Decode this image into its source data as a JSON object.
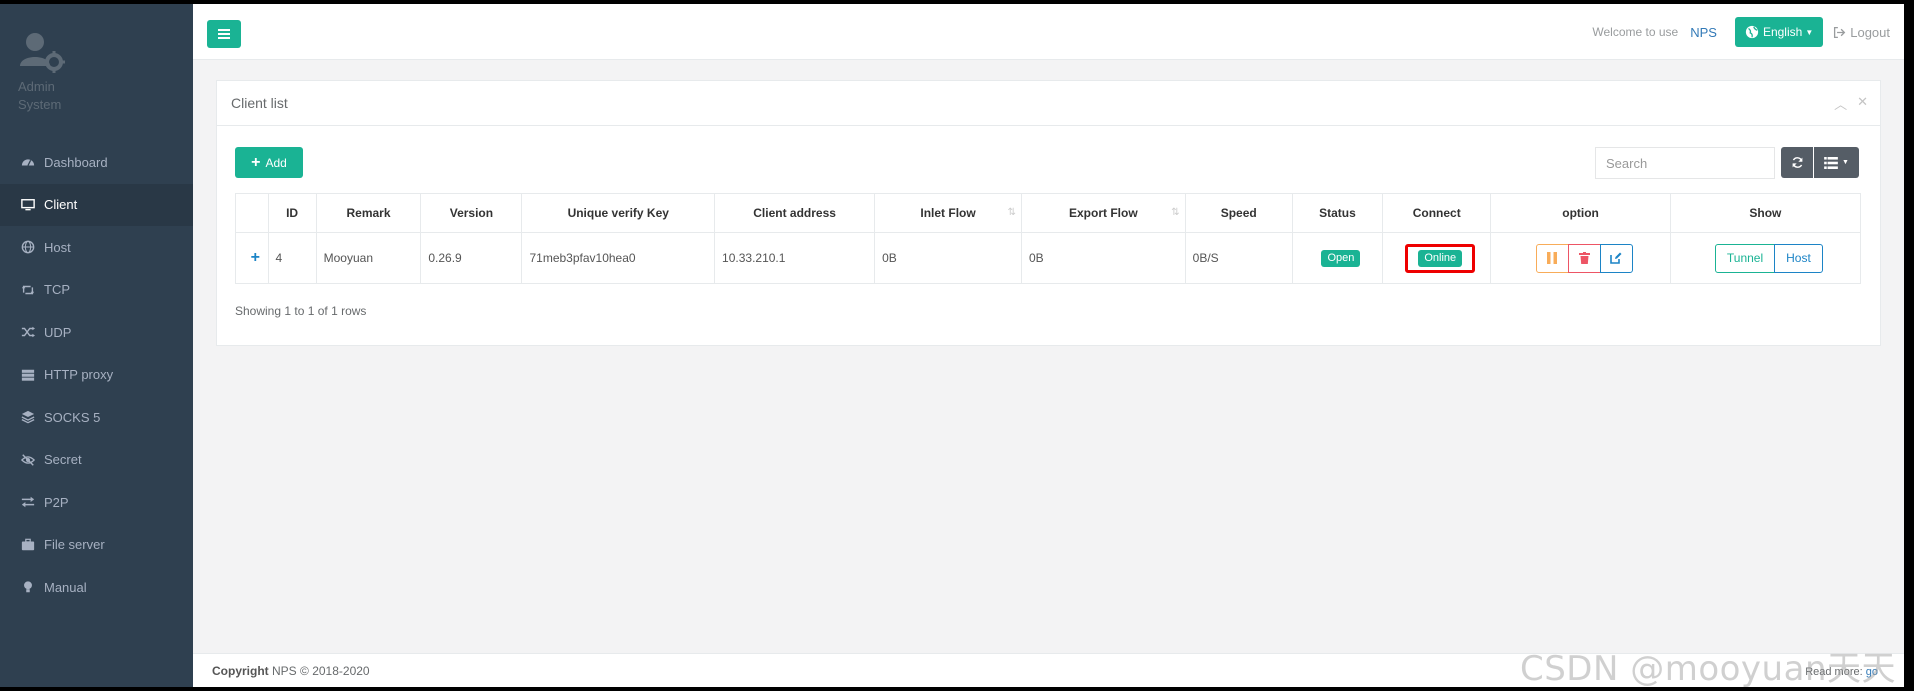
{
  "sidebar": {
    "profile": {
      "line1": "Admin",
      "line2": "System"
    },
    "items": [
      {
        "label": "Dashboard",
        "icon": "dashboard-icon",
        "active": false
      },
      {
        "label": "Client",
        "icon": "desktop-icon",
        "active": true
      },
      {
        "label": "Host",
        "icon": "globe-icon",
        "active": false
      },
      {
        "label": "TCP",
        "icon": "retweet-icon",
        "active": false
      },
      {
        "label": "UDP",
        "icon": "random-icon",
        "active": false
      },
      {
        "label": "HTTP proxy",
        "icon": "server-icon",
        "active": false
      },
      {
        "label": "SOCKS 5",
        "icon": "layers-icon",
        "active": false
      },
      {
        "label": "Secret",
        "icon": "eye-slash-icon",
        "active": false
      },
      {
        "label": "P2P",
        "icon": "exchange-icon",
        "active": false
      },
      {
        "label": "File server",
        "icon": "briefcase-icon",
        "active": false
      },
      {
        "label": "Manual",
        "icon": "lightbulb-icon",
        "active": false
      }
    ]
  },
  "topbar": {
    "welcome": "Welcome to use",
    "brand": "NPS",
    "language": "English",
    "logout": "Logout"
  },
  "panel": {
    "title": "Client list",
    "add_label": "Add",
    "search_placeholder": "Search",
    "columns": [
      "",
      "ID",
      "Remark",
      "Version",
      "Unique verify Key",
      "Client address",
      "Inlet Flow",
      "Export Flow",
      "Speed",
      "Status",
      "Connect",
      "option",
      "Show"
    ],
    "rows": [
      {
        "expand": "+",
        "id": "4",
        "remark": "Mooyuan",
        "version": "0.26.9",
        "key": "71meb3pfav10hea0",
        "address": "10.33.210.1",
        "inlet": "0B",
        "export": "0B",
        "speed": "0B/S",
        "status": "Open",
        "connect": "Online",
        "show_tunnel": "Tunnel",
        "show_host": "Host"
      }
    ],
    "pagination": "Showing 1 to 1 of 1 rows"
  },
  "footer": {
    "copyright_label": "Copyright",
    "copyright_text": "NPS © 2018-2020",
    "readmore": "Read more:",
    "readmore_link": "go"
  },
  "watermark": "CSDN @mooyuan天天",
  "colors": {
    "sidebar_bg": "#2f4050",
    "primary": "#1ab394",
    "warning": "#f8ac59",
    "danger": "#ed5565",
    "info": "#1c84c6",
    "highlight_border": "#ee0000"
  }
}
